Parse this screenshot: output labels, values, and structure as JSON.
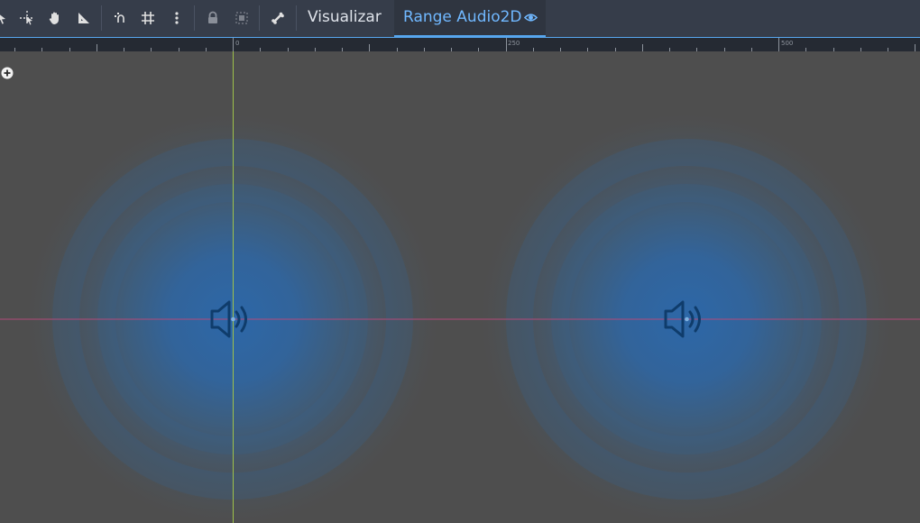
{
  "toolbar": {
    "icons": [
      "select-icon",
      "move-icon",
      "pan-icon",
      "ruler-icon",
      "smart-snap-icon",
      "grid-snap-icon",
      "more-options-icon",
      "lock-icon",
      "group-icon",
      "bone-icon"
    ],
    "view_menu_label": "Visualizar",
    "active_tab_label": "Range Audio2D",
    "active_tab_icon": "eye-icon"
  },
  "ruler": {
    "labels": [
      "0",
      "250",
      "500"
    ]
  },
  "viewport": {
    "nodes": [
      "AudioStreamPlayer2D",
      "AudioStreamPlayer2D"
    ],
    "node_icon": "speaker-icon",
    "range_color": "#2f6fb0",
    "x_axis_color": "#b34a7a",
    "y_axis_color": "#9fc24a"
  },
  "colors": {
    "accent": "#57a6ee",
    "toolbar_bg": "#363d4a",
    "canvas_bg": "#4e4e4e"
  }
}
